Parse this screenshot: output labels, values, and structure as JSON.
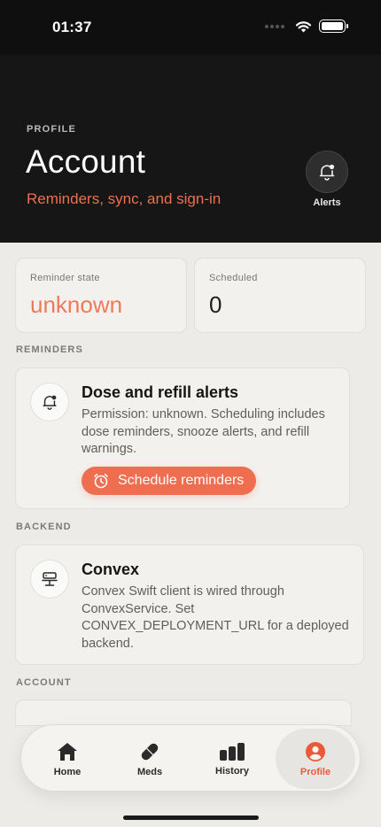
{
  "status_bar": {
    "time": "01:37"
  },
  "header": {
    "eyebrow": "PROFILE",
    "title": "Account",
    "subtitle": "Reminders, sync, and sign-in",
    "alerts_label": "Alerts"
  },
  "stats": [
    {
      "label": "Reminder state",
      "value": "unknown"
    },
    {
      "label": "Scheduled",
      "value": "0"
    }
  ],
  "sections": {
    "reminders": "REMINDERS",
    "backend": "BACKEND",
    "account": "ACCOUNT"
  },
  "reminders_card": {
    "icon": "bell-alert-icon",
    "title": "Dose and refill alerts",
    "body_lines": [
      "Permission: unknown. Scheduling includes",
      "dose reminders, snooze alerts, and refill",
      "warnings."
    ],
    "button_label": "Schedule reminders",
    "button_icon": "alarm-clock-icon"
  },
  "backend_card": {
    "icon": "server-icon",
    "title": "Convex",
    "body_lines": [
      "Convex Swift client is wired through",
      "ConvexService. Set",
      "CONVEX_DEPLOYMENT_URL for a deployed",
      "backend."
    ]
  },
  "tabbar": {
    "items": [
      {
        "label": "Home",
        "icon": "home-icon"
      },
      {
        "label": "Meds",
        "icon": "pill-icon"
      },
      {
        "label": "History",
        "icon": "bar-chart-icon"
      },
      {
        "label": "Profile",
        "icon": "person-icon",
        "active": true
      }
    ]
  },
  "colors": {
    "accent": "#ef6e4f",
    "header_bg": "#161616",
    "page_bg": "#ecebe7"
  }
}
